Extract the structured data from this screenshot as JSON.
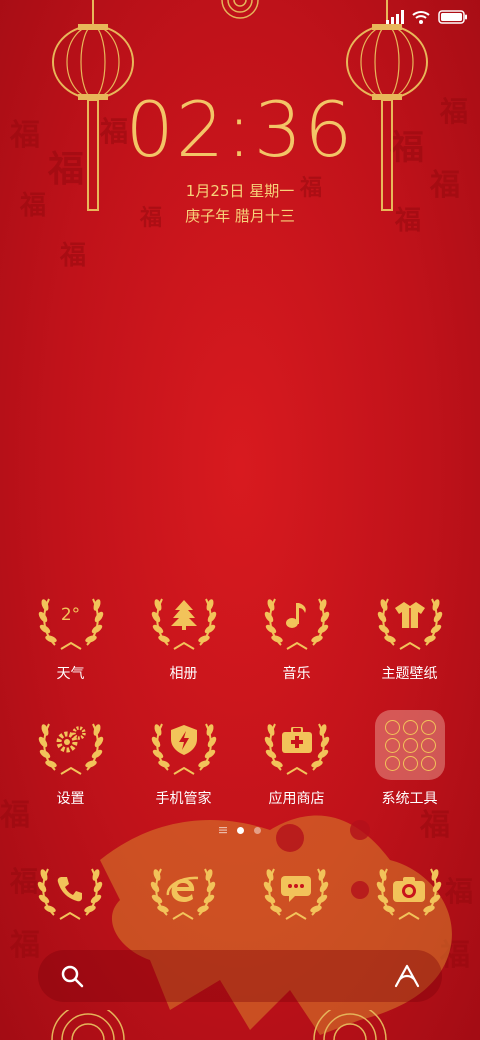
{
  "clock": {
    "time": "02:36",
    "date": "1月25日 星期一",
    "lunar": "庚子年 腊月十三"
  },
  "apps_row1": [
    {
      "label": "天气",
      "icon": "weather-icon",
      "glyph_text": "2°"
    },
    {
      "label": "相册",
      "icon": "gallery-icon"
    },
    {
      "label": "音乐",
      "icon": "music-icon"
    },
    {
      "label": "主题壁纸",
      "icon": "theme-icon"
    }
  ],
  "apps_row2": [
    {
      "label": "设置",
      "icon": "settings-icon"
    },
    {
      "label": "手机管家",
      "icon": "phone-manager-icon"
    },
    {
      "label": "应用商店",
      "icon": "app-store-icon"
    },
    {
      "label": "系统工具",
      "icon": "folder-icon"
    }
  ],
  "dock": [
    {
      "icon": "phone-icon"
    },
    {
      "icon": "browser-icon"
    },
    {
      "icon": "messages-icon"
    },
    {
      "icon": "camera-icon"
    }
  ],
  "page_indicator": {
    "pages": 2,
    "active": 1
  },
  "colors": {
    "gold": "#f2c35a",
    "background": "#c8141b"
  }
}
